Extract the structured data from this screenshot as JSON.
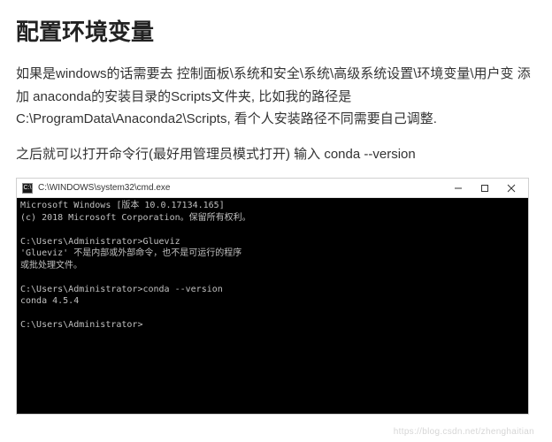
{
  "heading": "配置环境变量",
  "paragraph1": "如果是windows的话需要去 控制面板\\系统和安全\\系统\\高级系统设置\\环境变量\\用户变 添加 anaconda的安装目录的Scripts文件夹, 比如我的路径是C:\\ProgramData\\Anaconda2\\Scripts, 看个人安装路径不同需要自己调整.",
  "paragraph2": "之后就可以打开命令行(最好用管理员模式打开) 输入 conda --version",
  "terminal": {
    "title_path": "C:\\WINDOWS\\system32\\cmd.exe",
    "line_version": "Microsoft Windows [版本 10.0.17134.165]",
    "line_copyright": "(c) 2018 Microsoft Corporation。保留所有权利。",
    "line_prompt1_path": "C:\\Users\\Administrator>Glueviz",
    "line_error1": "'Glueviz' 不是内部或外部命令，也不是可运行的程序",
    "line_error2": "或批处理文件。",
    "line_prompt2": "C:\\Users\\Administrator>conda --version",
    "line_conda_output": "conda 4.5.4",
    "line_prompt3": "C:\\Users\\Administrator>"
  },
  "watermark": "https://blog.csdn.net/zhenghaitian"
}
